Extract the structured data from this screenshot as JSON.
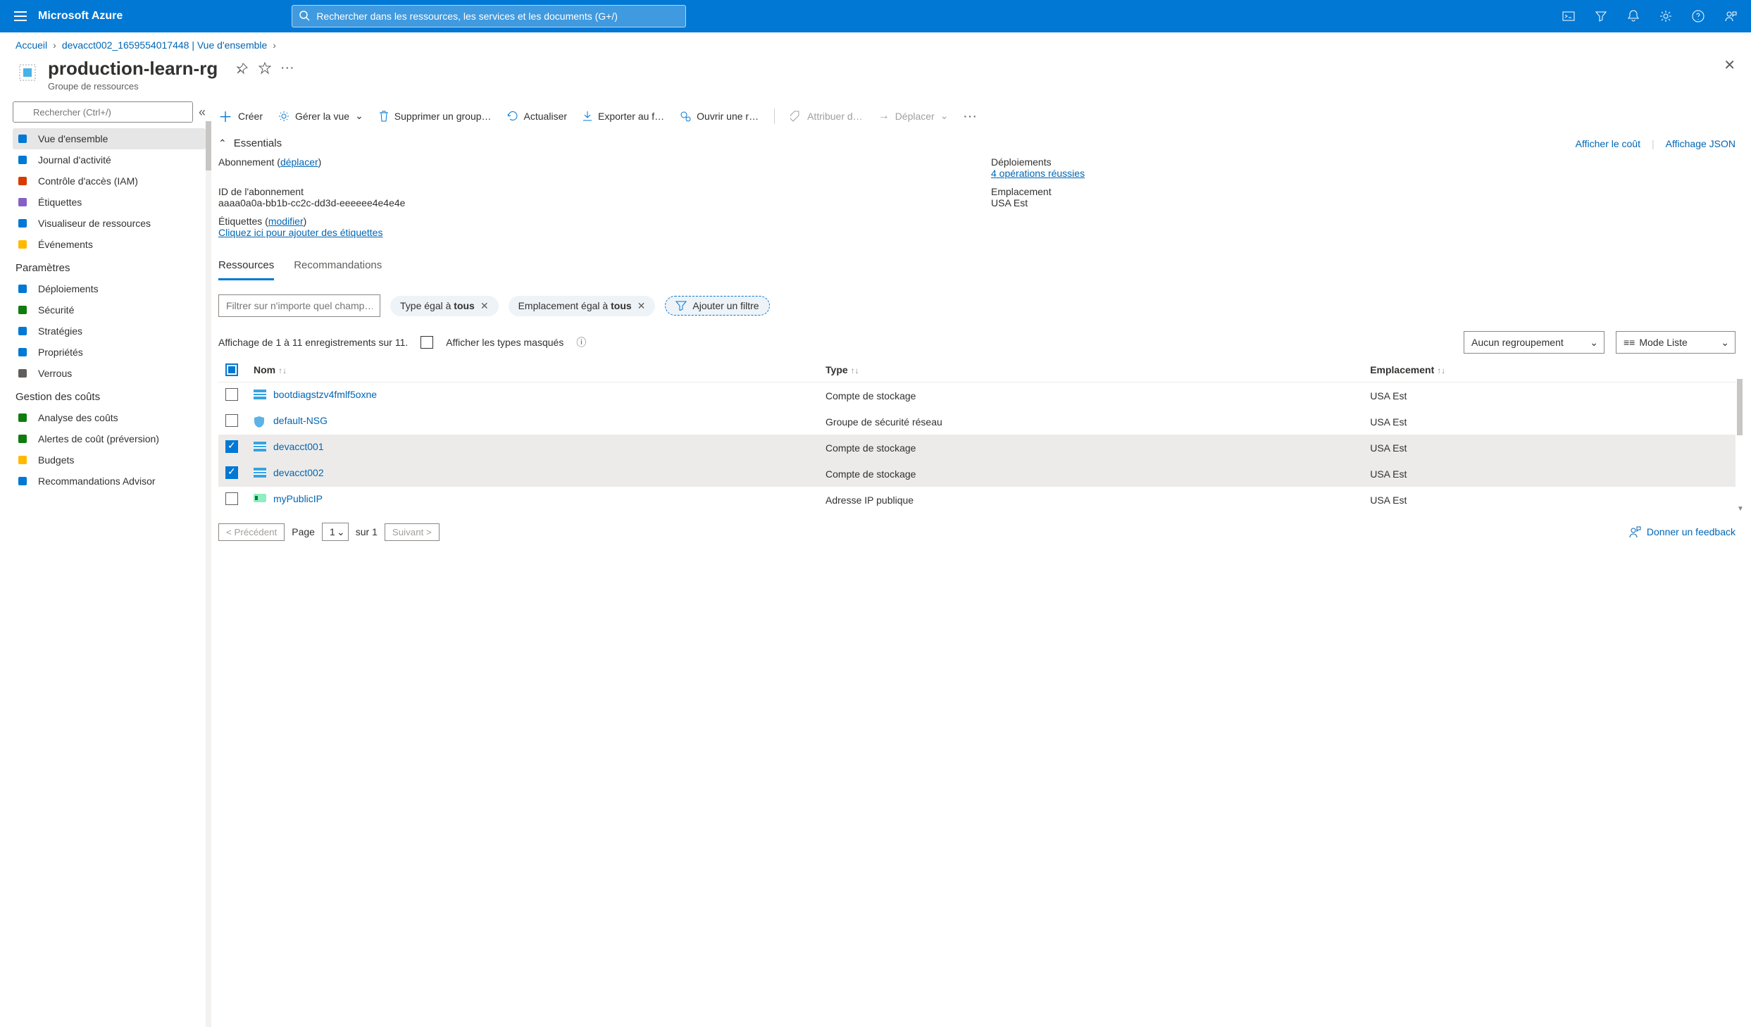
{
  "header": {
    "brand": "Microsoft Azure",
    "search_placeholder": "Rechercher dans les ressources, les services et les documents (G+/)"
  },
  "breadcrumb": {
    "home": "Accueil",
    "parent": "devacct002_1659554017448 | Vue d'ensemble"
  },
  "page": {
    "title": "production-learn-rg",
    "subtitle": "Groupe de ressources"
  },
  "side_search_placeholder": "Rechercher (Ctrl+/)",
  "sidebar": {
    "g1": [
      {
        "label": "Vue d'ensemble",
        "icon": "overview-icon",
        "active": true,
        "color": "#0078d4"
      },
      {
        "label": "Journal d'activité",
        "icon": "activity-log-icon",
        "color": "#0078d4"
      },
      {
        "label": "Contrôle d'accès (IAM)",
        "icon": "iam-icon",
        "color": "#d83b01"
      },
      {
        "label": "Étiquettes",
        "icon": "tags-icon",
        "color": "#8661c5"
      },
      {
        "label": "Visualiseur de ressources",
        "icon": "resource-visualizer-icon",
        "color": "#0078d4"
      },
      {
        "label": "Événements",
        "icon": "events-icon",
        "color": "#ffb900"
      }
    ],
    "s2_title": "Paramètres",
    "g2": [
      {
        "label": "Déploiements",
        "icon": "deployments-icon",
        "color": "#0078d4"
      },
      {
        "label": "Sécurité",
        "icon": "security-icon",
        "color": "#107c10"
      },
      {
        "label": "Stratégies",
        "icon": "policies-icon",
        "color": "#0078d4"
      },
      {
        "label": "Propriétés",
        "icon": "properties-icon",
        "color": "#0078d4"
      },
      {
        "label": "Verrous",
        "icon": "locks-icon",
        "color": "#605e5c"
      }
    ],
    "s3_title": "Gestion des coûts",
    "g3": [
      {
        "label": "Analyse des coûts",
        "icon": "cost-analysis-icon",
        "color": "#107c10"
      },
      {
        "label": "Alertes de coût (préversion)",
        "icon": "cost-alerts-icon",
        "color": "#107c10"
      },
      {
        "label": "Budgets",
        "icon": "budgets-icon",
        "color": "#ffb900"
      },
      {
        "label": "Recommandations Advisor",
        "icon": "advisor-icon",
        "color": "#0078d4"
      }
    ]
  },
  "toolbar": {
    "create": "Créer",
    "manage_view": "Gérer la vue",
    "delete": "Supprimer un group…",
    "refresh": "Actualiser",
    "export": "Exporter au f…",
    "open": "Ouvrir une r…",
    "assign": "Attribuer d…",
    "move": "Déplacer"
  },
  "essentials": {
    "title": "Essentials",
    "show_cost": "Afficher le coût",
    "json_view": "Affichage JSON",
    "sub_label": "Abonnement (",
    "sub_move": "déplacer",
    "sub_close": ")",
    "deploy_label": "Déploiements",
    "deploy_value": "4 opérations réussies",
    "subid_label": "ID de l'abonnement",
    "subid_value": "aaaa0a0a-bb1b-cc2c-dd3d-eeeeee4e4e4e",
    "loc_label": "Emplacement",
    "loc_value": "USA Est",
    "tags_label": "Étiquettes (",
    "tags_edit": "modifier",
    "tags_close": ")",
    "tags_add": "Cliquez ici pour ajouter des étiquettes"
  },
  "tabs": {
    "resources": "Ressources",
    "reco": "Recommandations"
  },
  "filters": {
    "placeholder": "Filtrer sur n'importe quel champ…",
    "type_prefix": "Type égal à ",
    "type_value": "tous",
    "loc_prefix": "Emplacement égal à ",
    "loc_value": "tous",
    "add": "Ajouter un filtre"
  },
  "summary": {
    "count_text": "Affichage de 1 à 11 enregistrements sur 11.",
    "show_hidden": "Afficher les types masqués",
    "grouping": "Aucun regroupement",
    "view_mode": "Mode Liste"
  },
  "table": {
    "col_name": "Nom",
    "col_type": "Type",
    "col_loc": "Emplacement",
    "rows": [
      {
        "name": "bootdiagstzv4fmlf5oxne",
        "type": "Compte de stockage",
        "loc": "USA Est",
        "sel": false,
        "icon": "storage-icon"
      },
      {
        "name": "default-NSG",
        "type": "Groupe de sécurité réseau",
        "loc": "USA Est",
        "sel": false,
        "icon": "shield-icon"
      },
      {
        "name": "devacct001",
        "type": "Compte de stockage",
        "loc": "USA Est",
        "sel": true,
        "icon": "storage-icon"
      },
      {
        "name": "devacct002",
        "type": "Compte de stockage",
        "loc": "USA Est",
        "sel": true,
        "icon": "storage-icon"
      },
      {
        "name": "myPublicIP",
        "type": "Adresse IP publique",
        "loc": "USA Est",
        "sel": false,
        "icon": "ip-icon"
      }
    ]
  },
  "pager": {
    "prev": "< Précédent",
    "page_label": "Page",
    "page_value": "1",
    "of_label": "sur 1",
    "next": "Suivant >",
    "feedback": "Donner un feedback"
  }
}
